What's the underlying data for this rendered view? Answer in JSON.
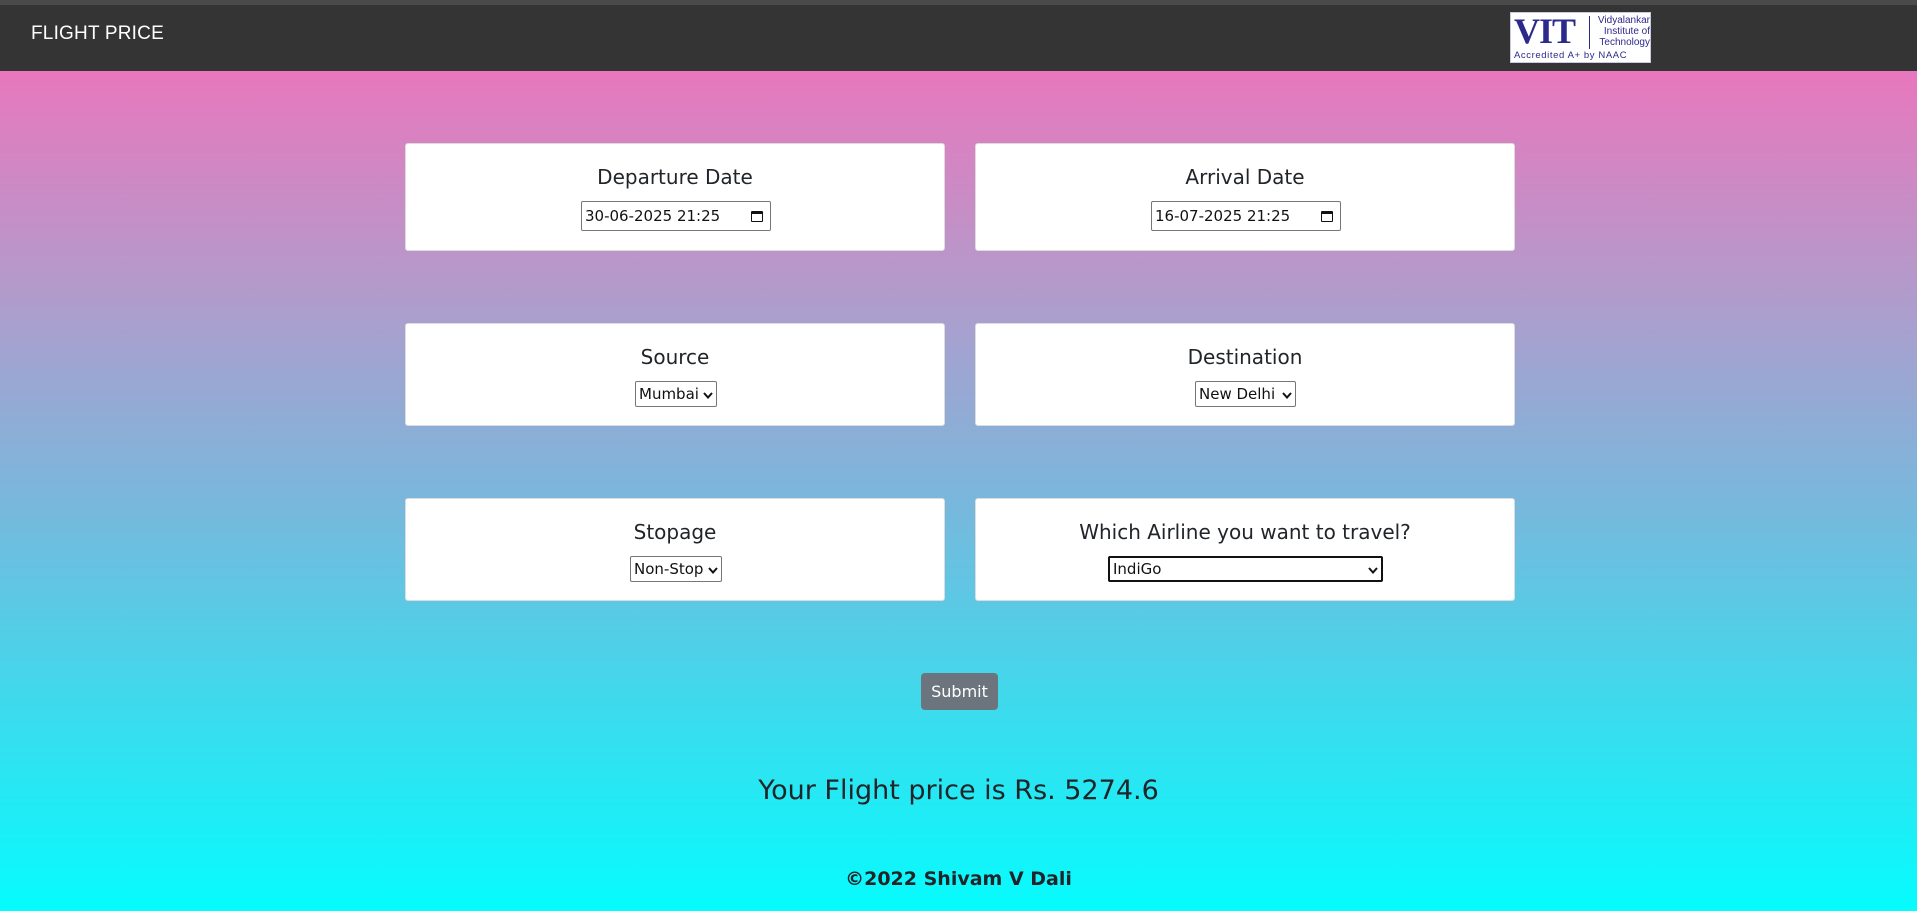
{
  "navbar": {
    "brand": "FLIGHT PRICE",
    "logo": {
      "main": "VIT",
      "line1": "Vidyalankar",
      "line2": "Institute of",
      "line3": "Technology",
      "accreditation": "Accredited A+ by NAAC"
    }
  },
  "form": {
    "departure": {
      "label": "Departure Date",
      "value": "30-06-2025 21:25"
    },
    "arrival": {
      "label": "Arrival Date",
      "value": "16-07-2025 21:25"
    },
    "source": {
      "label": "Source",
      "selected": "Mumbai"
    },
    "destination": {
      "label": "Destination",
      "selected": "New Delhi"
    },
    "stopage": {
      "label": "Stopage",
      "selected": "Non-Stop"
    },
    "airline": {
      "label": "Which Airline you want to travel?",
      "selected": "IndiGo"
    },
    "submit_label": "Submit"
  },
  "result": "Your Flight price is Rs. 5274.6",
  "footer": "©2022 Shivam V Dali",
  "colors": {
    "navbar": "#343434",
    "gradient_top": "#e977bd",
    "gradient_bottom": "#05fcfe",
    "submit_button": "#6c757d"
  },
  "icons": {
    "date_picker": "calendar-icon",
    "select": "chevron-down-icon"
  }
}
